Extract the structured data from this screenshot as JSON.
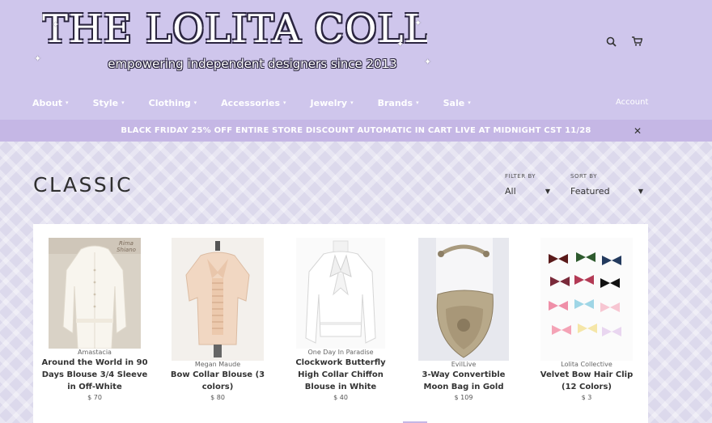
{
  "logo": {
    "title": "THE LOLITA COLLECTIVE",
    "subtitle": "empowering independent designers since 2013"
  },
  "header": {
    "search_icon": "search-icon",
    "cart_icon": "cart-icon",
    "account_label": "Account"
  },
  "nav": {
    "items": [
      {
        "label": "About"
      },
      {
        "label": "Style"
      },
      {
        "label": "Clothing"
      },
      {
        "label": "Accessories"
      },
      {
        "label": "Jewelry"
      },
      {
        "label": "Brands"
      },
      {
        "label": "Sale"
      }
    ]
  },
  "announcement": {
    "text": "BLACK FRIDAY 25% OFF ENTIRE STORE DISCOUNT AUTOMATIC IN CART LIVE AT MIDNIGHT CST 11/28",
    "close_icon": "close-icon"
  },
  "collection": {
    "title": "CLASSIC",
    "filter_label": "FILTER BY",
    "filter_value": "All",
    "sort_label": "SORT BY",
    "sort_value": "Featured"
  },
  "products": [
    {
      "vendor": "Amastacia",
      "name": "Around the World in 90 Days Blouse 3/4 Sleeve in Off-White",
      "price": "$ 70",
      "image_label": "Rima Shiano"
    },
    {
      "vendor": "Megan Maude",
      "name": "Bow Collar Blouse (3 colors)",
      "price": "$ 80"
    },
    {
      "vendor": "One Day In Paradise",
      "name": "Clockwork Butterfly High Collar Chiffon Blouse in White",
      "price": "$ 40"
    },
    {
      "vendor": "EvilLive",
      "name": "3-Way Convertible Moon Bag in Gold",
      "price": "$ 109"
    },
    {
      "vendor": "Lolita Collective",
      "name": "Velvet Bow Hair Clip (12 Colors)",
      "price": "$ 3"
    }
  ],
  "colors": {
    "header_bg": "#cfc6ec",
    "announce_bg": "#c5b7e5",
    "page_bg": "#dcd9ec"
  }
}
